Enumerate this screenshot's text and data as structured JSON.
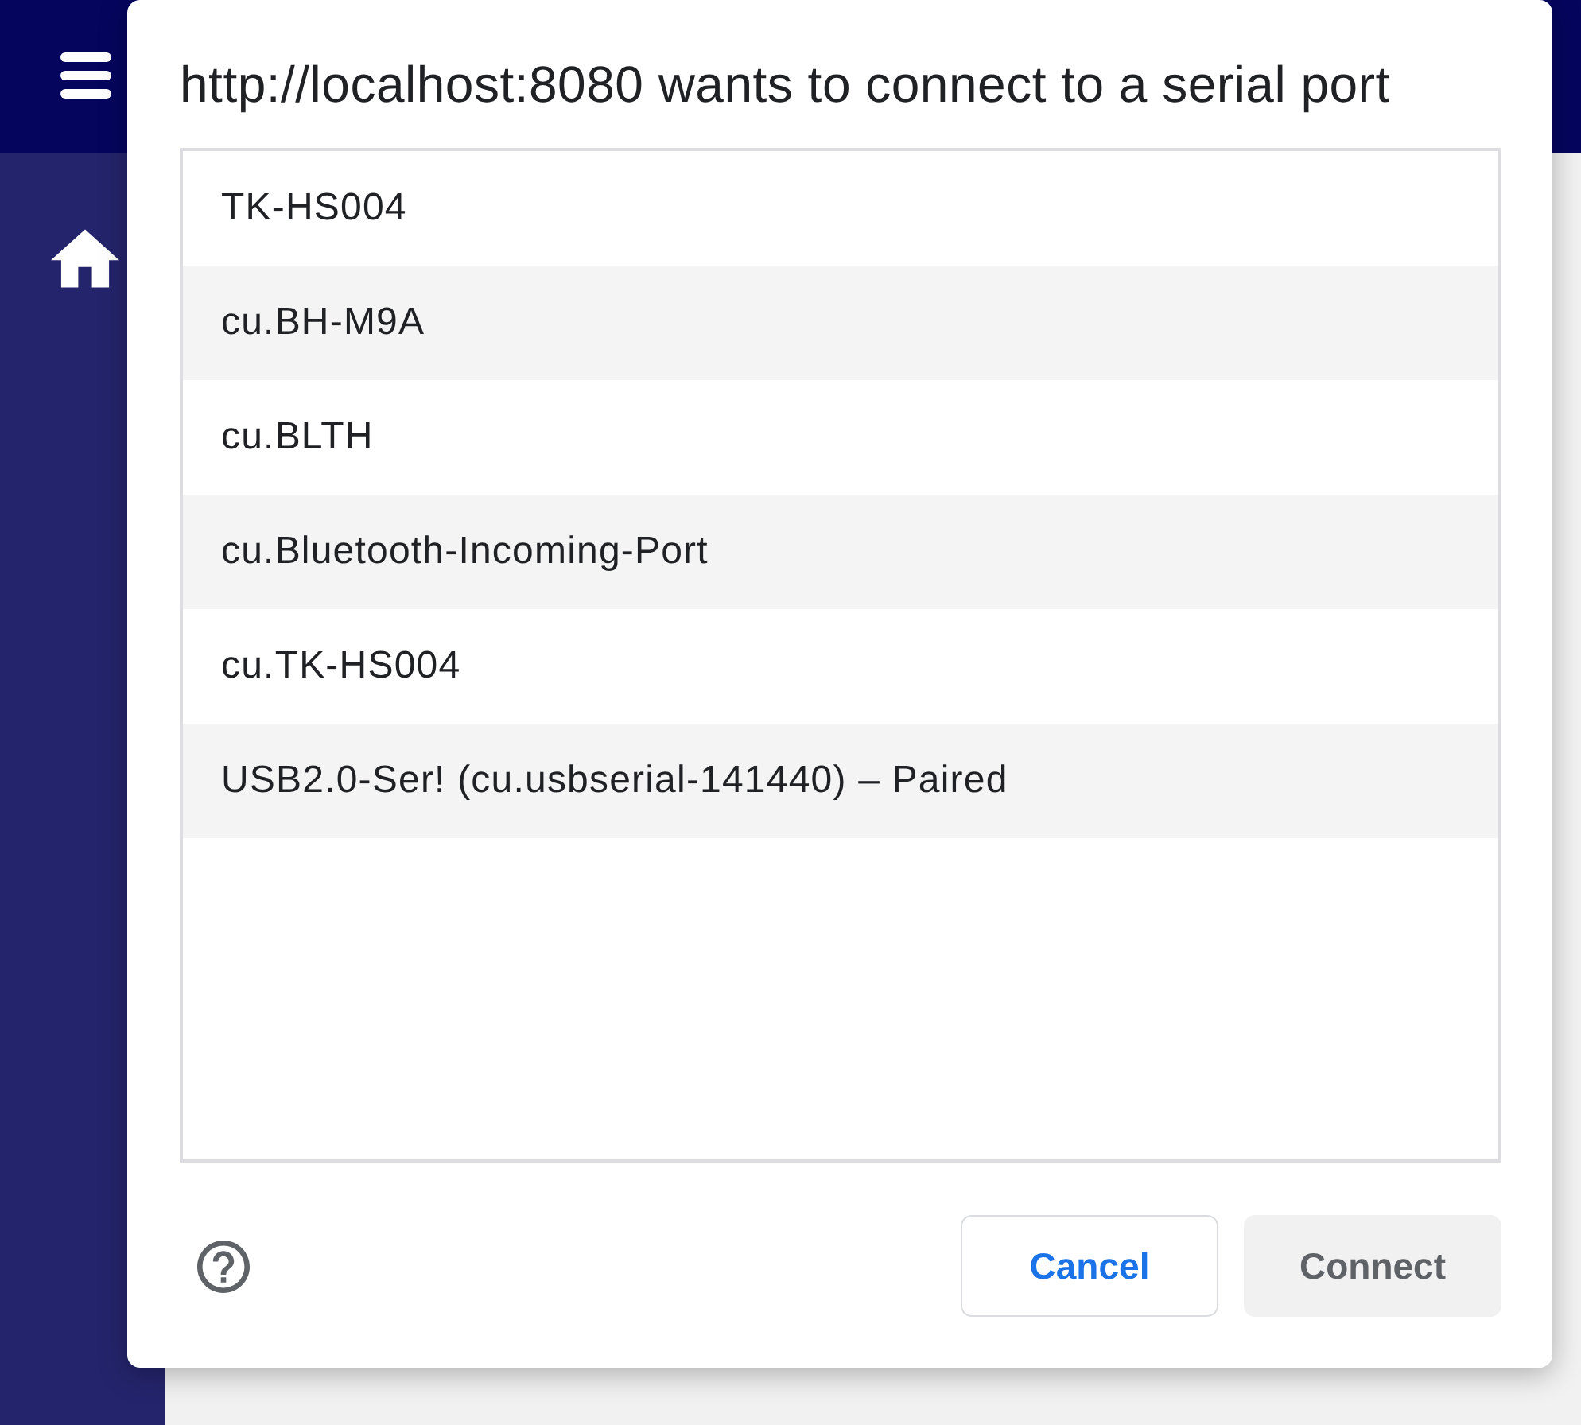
{
  "dialog": {
    "title": "http://localhost:8080 wants to connect to a serial port",
    "ports": [
      {
        "name": "TK-HS004",
        "selected": false
      },
      {
        "name": "cu.BH-M9A",
        "selected": false
      },
      {
        "name": "cu.BLTH",
        "selected": false
      },
      {
        "name": "cu.Bluetooth-Incoming-Port",
        "selected": false
      },
      {
        "name": "cu.TK-HS004",
        "selected": false
      },
      {
        "name": "USB2.0-Ser! (cu.usbserial-141440) – Paired",
        "selected": false
      }
    ],
    "buttons": [
      {
        "label": "Cancel",
        "kind": "secondary",
        "disabled": false
      },
      {
        "label": "Connect",
        "kind": "primary",
        "disabled": true
      }
    ]
  }
}
